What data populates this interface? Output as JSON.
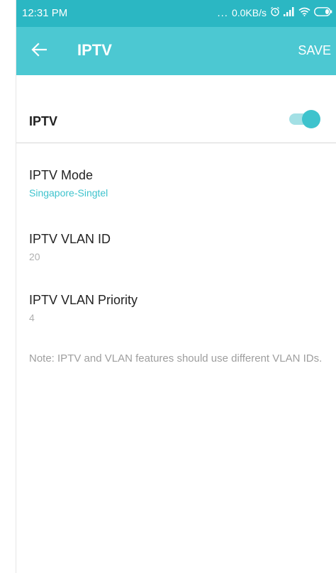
{
  "status_bar": {
    "time": "12:31 PM",
    "dots": "...",
    "speed": "0.0KB/s",
    "icons": [
      "alarm-icon",
      "signal-icon",
      "wifi-icon",
      "battery-icon"
    ]
  },
  "app_bar": {
    "title": "IPTV",
    "save_label": "SAVE",
    "back_icon": "arrow-left-icon",
    "color": "#4cc8d2"
  },
  "iptv_toggle": {
    "label": "IPTV",
    "enabled": true,
    "accent_color": "#3ec3cd"
  },
  "settings": [
    {
      "title": "IPTV Mode",
      "value": "Singapore-Singtel"
    },
    {
      "title": "IPTV VLAN ID",
      "value": "20"
    },
    {
      "title": "IPTV VLAN Priority",
      "value": "4"
    }
  ],
  "note": "Note: IPTV and VLAN features should use different VLAN IDs."
}
